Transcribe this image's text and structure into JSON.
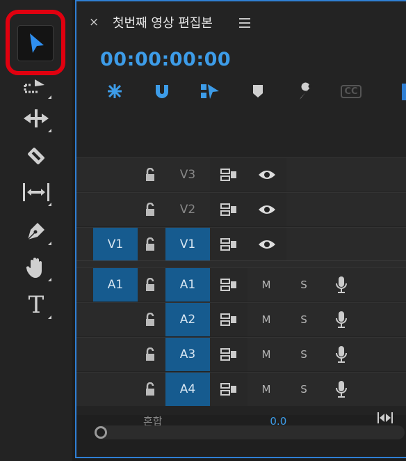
{
  "window": {
    "title": "첫번째 영상 편집본",
    "close_label": "×"
  },
  "timecode": "00:00:00:00",
  "tools": [
    {
      "name": "selection-tool",
      "icon": "arrow-icon"
    },
    {
      "name": "track-select-tool",
      "icon": "track-select-icon"
    },
    {
      "name": "ripple-edit-tool",
      "icon": "ripple-icon"
    },
    {
      "name": "razor-tool",
      "icon": "razor-icon"
    },
    {
      "name": "slip-tool",
      "icon": "slip-icon"
    },
    {
      "name": "pen-tool",
      "icon": "pen-icon"
    },
    {
      "name": "hand-tool",
      "icon": "hand-icon"
    },
    {
      "name": "type-tool",
      "icon": "type-icon",
      "label": "T"
    }
  ],
  "timeline_toolbar": [
    "nest-icon",
    "snap-icon",
    "linked-selection-icon",
    "marker-icon",
    "settings-icon",
    "captions-icon"
  ],
  "captions_label": "CC",
  "video_tracks": [
    {
      "label": "V3",
      "source": ""
    },
    {
      "label": "V2",
      "source": ""
    },
    {
      "label": "V1",
      "source": "V1"
    }
  ],
  "audio_tracks": [
    {
      "label": "A1",
      "source": "A1",
      "mute": "M",
      "solo": "S"
    },
    {
      "label": "A2",
      "source": "",
      "mute": "M",
      "solo": "S"
    },
    {
      "label": "A3",
      "source": "",
      "mute": "M",
      "solo": "S"
    },
    {
      "label": "A4",
      "source": "",
      "mute": "M",
      "solo": "S"
    }
  ],
  "mix": {
    "label": "혼합",
    "value": "0.0"
  },
  "colors": {
    "accent": "#3d9ce8",
    "highlight": "#e0000f",
    "patch": "#165b8f"
  }
}
